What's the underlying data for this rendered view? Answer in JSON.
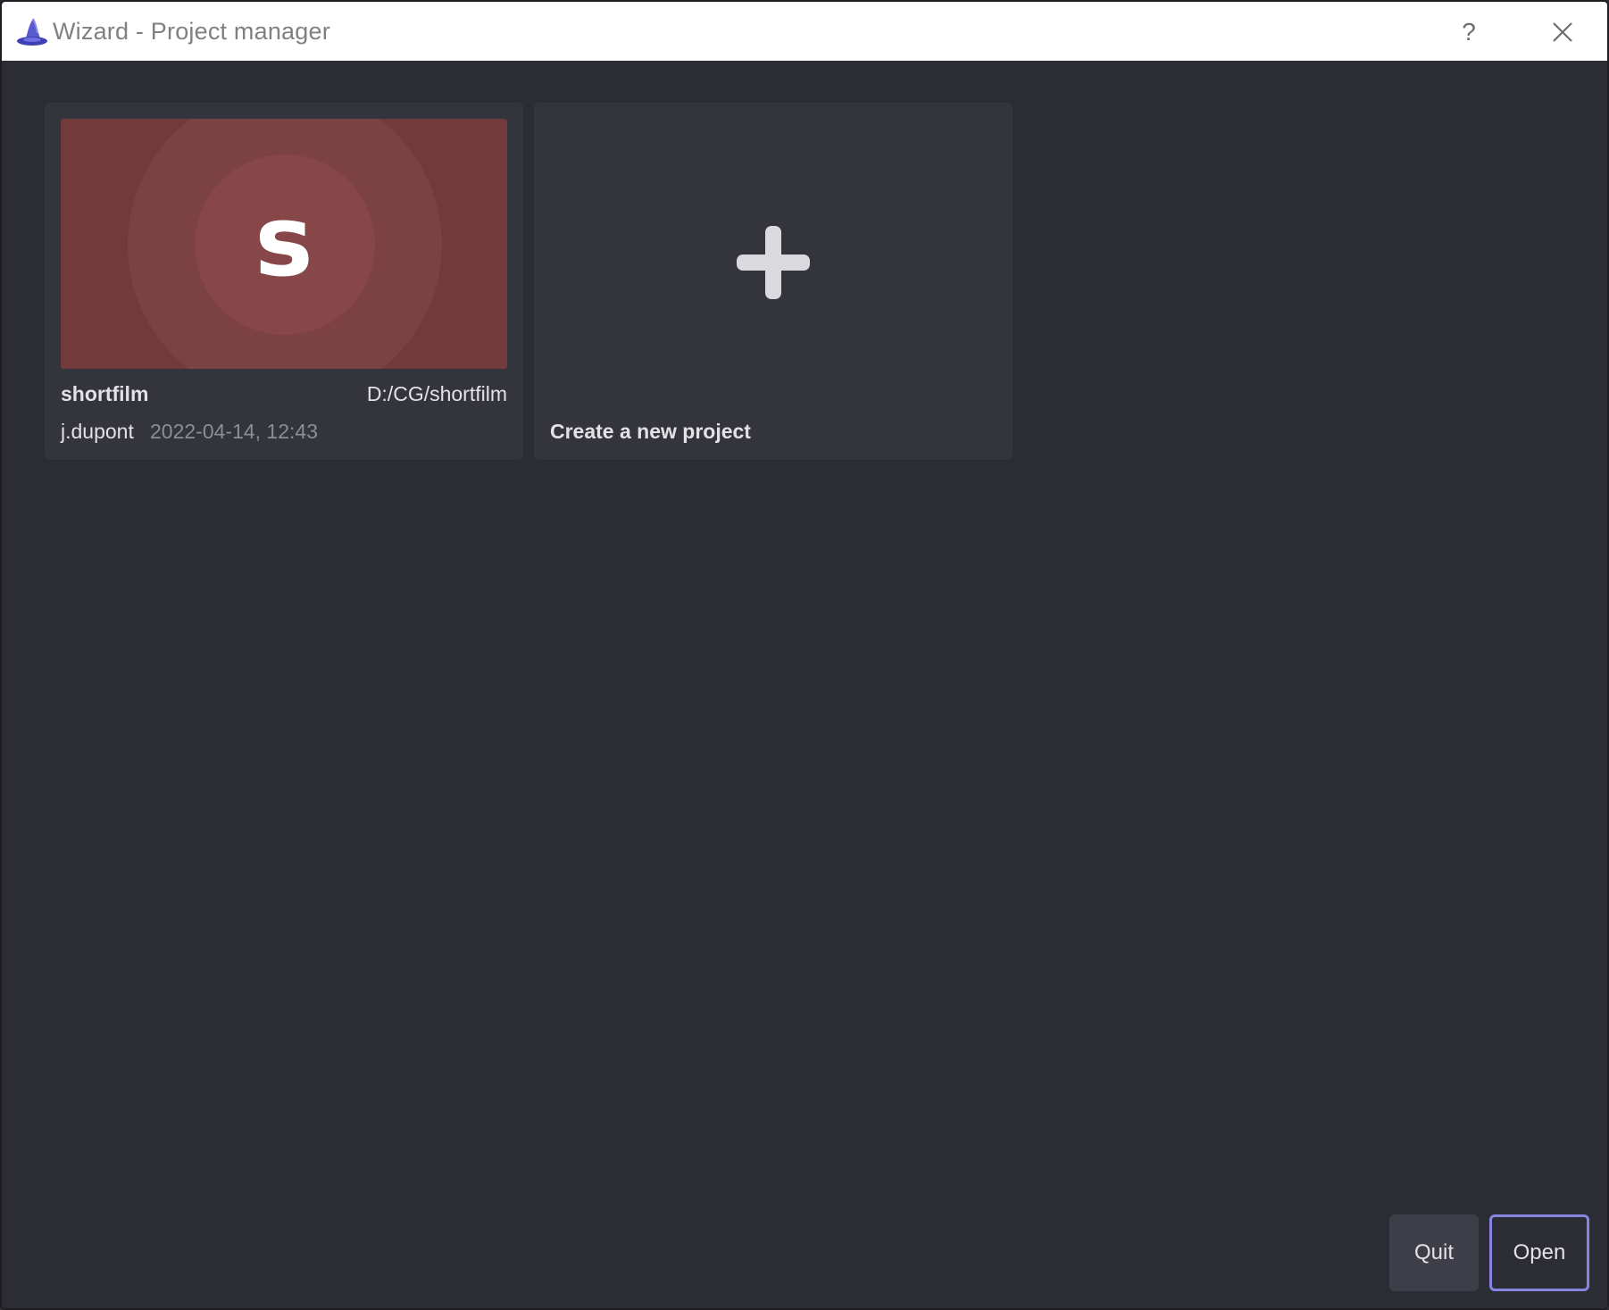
{
  "window": {
    "title": "Wizard - Project manager",
    "help_label": "?",
    "close_label": "✕",
    "accent_color": "#8585e0"
  },
  "projects": [
    {
      "thumbnail_letter": "s",
      "thumbnail_color": "#723a3b",
      "name": "shortfilm",
      "path": "D:/CG/shortfilm",
      "user": "j.dupont",
      "date": "2022-04-14, 12:43"
    }
  ],
  "new_project": {
    "icon": "plus-icon",
    "label": "Create a new project"
  },
  "footer": {
    "quit_label": "Quit",
    "open_label": "Open"
  }
}
